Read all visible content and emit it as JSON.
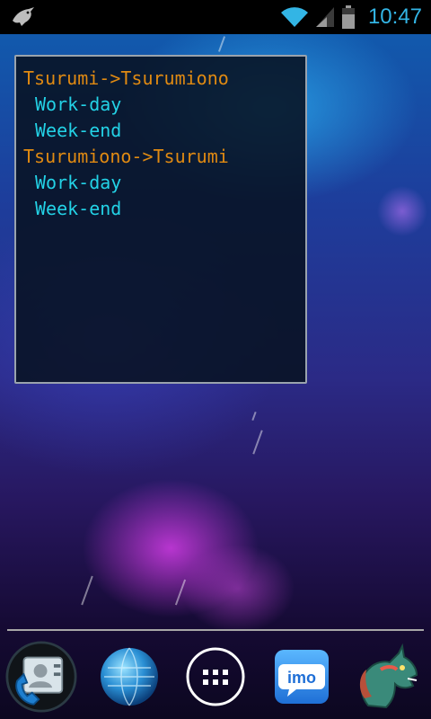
{
  "status_bar": {
    "time": "10:47",
    "icons": [
      "notification-bird-icon",
      "wifi-icon",
      "signal-icon",
      "battery-icon"
    ]
  },
  "widget": {
    "routes": [
      {
        "name": "Tsurumi->Tsurumiono",
        "options": [
          "Work-day",
          "Week-end"
        ]
      },
      {
        "name": "Tsurumiono->Tsurumi",
        "options": [
          "Work-day",
          "Week-end"
        ]
      }
    ]
  },
  "dock": {
    "apps": [
      "contacts-phone-icon",
      "browser-globe-icon",
      "app-drawer-icon",
      "imo-icon",
      "dragon-app-icon"
    ],
    "imo_label": "imo"
  },
  "colors": {
    "clock": "#33b5e5",
    "route": "#e08a12",
    "option": "#23d2e6"
  }
}
